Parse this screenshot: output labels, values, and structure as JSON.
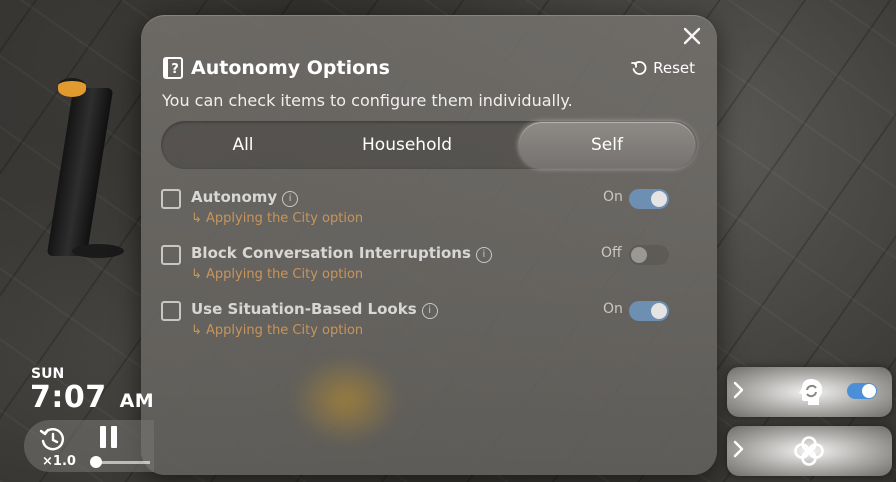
{
  "dialog": {
    "title": "Autonomy Options",
    "reset_label": "Reset",
    "subtitle": "You can check items to configure them individually.",
    "close_icon": "close-icon"
  },
  "tabs": [
    {
      "label": "All",
      "selected": false
    },
    {
      "label": "Household",
      "selected": false
    },
    {
      "label": "Self",
      "selected": true
    }
  ],
  "options": [
    {
      "label": "Autonomy",
      "sub": "Applying the City option",
      "state": "On",
      "checked": false
    },
    {
      "label": "Block Conversation Interruptions",
      "sub": "Applying the City option",
      "state": "Off",
      "checked": false
    },
    {
      "label": "Use Situation-Based Looks",
      "sub": "Applying the City option",
      "state": "On",
      "checked": false
    }
  ],
  "hud": {
    "day": "SUN",
    "time": "7:07",
    "ampm": "AM",
    "speed": "×1.0"
  },
  "colors": {
    "toggle_on": "#6d8fb1",
    "sub_text": "#c8955a",
    "accent_blue": "#4d8fd6"
  }
}
